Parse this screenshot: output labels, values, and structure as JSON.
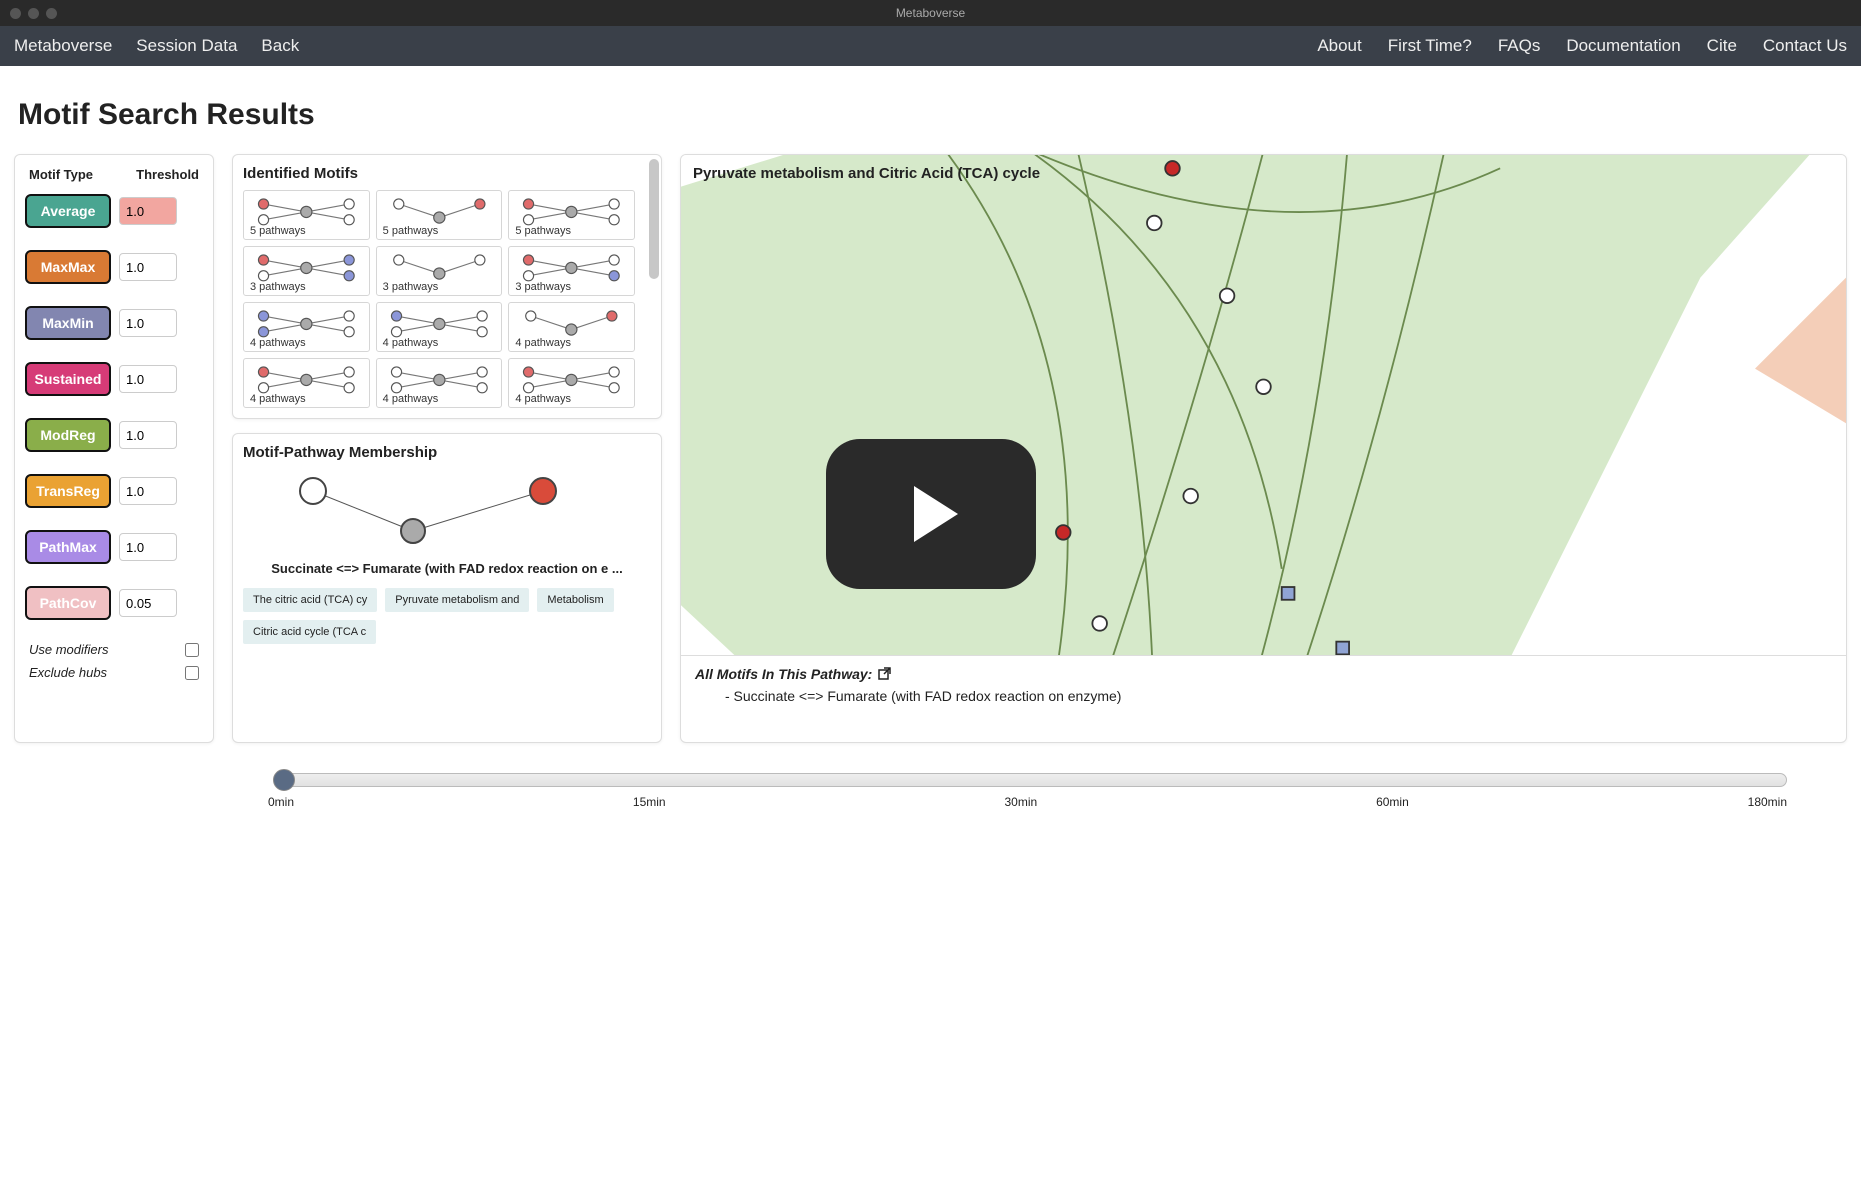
{
  "app": {
    "title": "Metaboverse"
  },
  "menubar": {
    "left": [
      "Metaboverse",
      "Session Data",
      "Back"
    ],
    "right": [
      "About",
      "First Time?",
      "FAQs",
      "Documentation",
      "Cite",
      "Contact Us"
    ]
  },
  "page_title": "Motif Search Results",
  "sidebar": {
    "headers": {
      "type": "Motif Type",
      "threshold": "Threshold"
    },
    "motifs": [
      {
        "name": "Average",
        "color": "#4aa591",
        "value": "1.0",
        "active": true
      },
      {
        "name": "MaxMax",
        "color": "#d97a34",
        "value": "1.0",
        "active": false
      },
      {
        "name": "MaxMin",
        "color": "#8286b0",
        "value": "1.0",
        "active": false
      },
      {
        "name": "Sustained",
        "color": "#d63b77",
        "value": "1.0",
        "active": false
      },
      {
        "name": "ModReg",
        "color": "#8aae4a",
        "value": "1.0",
        "active": false
      },
      {
        "name": "TransReg",
        "color": "#eaa233",
        "value": "1.0",
        "active": false
      },
      {
        "name": "PathMax",
        "color": "#a98be6",
        "value": "1.0",
        "active": false
      },
      {
        "name": "PathCov",
        "color": "#f0c0c3",
        "value": "0.05",
        "active": false
      }
    ],
    "checks": {
      "modifiers": "Use modifiers",
      "hubs": "Exclude hubs"
    }
  },
  "identified": {
    "title": "Identified Motifs",
    "cells": [
      {
        "caption": "5 pathways",
        "variant": "x",
        "colors": [
          "red",
          "white",
          "white",
          "white"
        ]
      },
      {
        "caption": "5 pathways",
        "variant": "y",
        "colors": [
          "white",
          "red"
        ]
      },
      {
        "caption": "5 pathways",
        "variant": "x",
        "colors": [
          "red",
          "white",
          "white",
          "white"
        ]
      },
      {
        "caption": "3 pathways",
        "variant": "x",
        "colors": [
          "red",
          "white",
          "blue",
          "blue"
        ]
      },
      {
        "caption": "3 pathways",
        "variant": "y",
        "colors": [
          "white",
          "white"
        ]
      },
      {
        "caption": "3 pathways",
        "variant": "x",
        "colors": [
          "red",
          "white",
          "white",
          "blue"
        ]
      },
      {
        "caption": "4 pathways",
        "variant": "x",
        "colors": [
          "blue",
          "blue",
          "white",
          "white"
        ]
      },
      {
        "caption": "4 pathways",
        "variant": "x",
        "colors": [
          "blue",
          "white",
          "white",
          "white"
        ]
      },
      {
        "caption": "4 pathways",
        "variant": "y",
        "colors": [
          "white",
          "red"
        ]
      },
      {
        "caption": "4 pathways",
        "variant": "x",
        "colors": [
          "red",
          "white",
          "white",
          "white"
        ]
      },
      {
        "caption": "4 pathways",
        "variant": "x",
        "colors": [
          "white",
          "white",
          "white",
          "white"
        ]
      },
      {
        "caption": "4 pathways",
        "variant": "x",
        "colors": [
          "red",
          "white",
          "white",
          "white"
        ]
      }
    ]
  },
  "membership": {
    "title": "Motif-Pathway Membership",
    "reaction": "Succinate <=> Fumarate (with FAD redox reaction on e ...",
    "paths": [
      "The citric acid (TCA) cy",
      "Pyruvate metabolism and",
      "Metabolism",
      "Citric acid cycle (TCA c"
    ]
  },
  "viz": {
    "title": "Pyruvate metabolism and Citric Acid (TCA) cycle",
    "footer_title": "All Motifs In This Pathway:",
    "footer_items": [
      "- Succinate <=> Fumarate (with FAD redox reaction on enzyme)"
    ]
  },
  "timeline": {
    "ticks": [
      "0min",
      "15min",
      "30min",
      "60min",
      "180min"
    ]
  },
  "icons": {
    "external": "↗"
  }
}
